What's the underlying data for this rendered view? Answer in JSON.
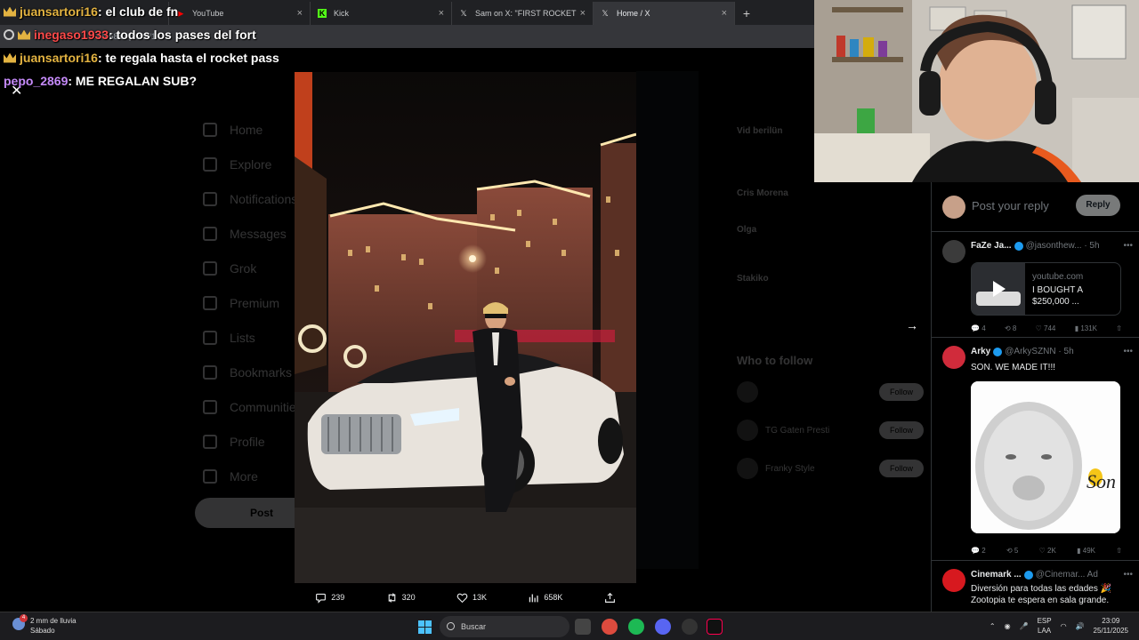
{
  "browser": {
    "tabs": [
      {
        "title": "YouTube",
        "icon": "youtube-icon",
        "active": false
      },
      {
        "title": "Kick",
        "icon": "kick-icon",
        "active": false
      },
      {
        "title": "Sam on X: \"FIRST ROCKET LEAG",
        "icon": "x-logo-icon",
        "active": false
      },
      {
        "title": "Home / X",
        "icon": "x-logo-icon",
        "active": true
      }
    ],
    "url": "...1765816/photo/1"
  },
  "chat": [
    {
      "user": "juansartori16",
      "message": " : el club de fn",
      "user_color": "#e3b341"
    },
    {
      "user": "inegaso1933",
      "message": " : todos los pases del fort",
      "user_color": "#ff4a4a"
    },
    {
      "user": "juansartori16",
      "message": " : te regala hasta el rocket pass",
      "user_color": "#e3b341"
    },
    {
      "user": "pepo_2869",
      "message": " : ME REGALAN SUB?",
      "user_color": "#c58af9"
    }
  ],
  "twitter_bg": {
    "sidebar": [
      "Home",
      "Explore",
      "Notifications",
      "Messages",
      "Grok",
      "Premium",
      "Lists",
      "Bookmarks",
      "Communities",
      "Profile",
      "More"
    ],
    "post_label": "Post",
    "trends": [
      {
        "name": "Vid berilün",
        "sub": ""
      },
      {
        "name": "Cris Morena",
        "sub": ""
      },
      {
        "name": "Olga",
        "sub": ""
      },
      {
        "name": "Stakiko",
        "sub": ""
      }
    ],
    "who_to_follow": "Who to follow",
    "follow_label": "Follow",
    "suggestions": [
      "TG Gaten Presti",
      "Franky Style"
    ]
  },
  "photo_actions": {
    "replies": "239",
    "reposts": "320",
    "likes": "13K",
    "views": "658K"
  },
  "reply_panel": {
    "placeholder": "Post your reply",
    "reply_button": "Reply",
    "tweets": [
      {
        "name": "FaZe Ja...",
        "handle": "@jasonthew... · 5h",
        "card_domain": "youtube.com",
        "card_title": "I BOUGHT A $250,000 ...",
        "stats": {
          "replies": "4",
          "reposts": "8",
          "likes": "744",
          "views": "131K"
        }
      },
      {
        "name": "Arky",
        "handle": "@ArkySZNN · 5h",
        "text": "SON. WE MADE IT!!!",
        "image_caption": "Son",
        "stats": {
          "replies": "2",
          "reposts": "5",
          "likes": "2K",
          "views": "49K"
        }
      },
      {
        "name": "Cinemark ...",
        "handle": "@Cinemar... Ad",
        "text1": "Diversión para todas las edades 🎉",
        "text2": "Zootopia te espera en sala grande."
      }
    ]
  },
  "taskbar": {
    "weather_line1": "2 mm de lluvia",
    "weather_line2": "Sábado",
    "weather_badge": "4",
    "search_placeholder": "Buscar",
    "lang1": "ESP",
    "lang2": "LAA",
    "time": "23:09",
    "date": "25/11/2025"
  },
  "colors": {
    "accent": "#1d9bf0",
    "bg": "#000000",
    "text": "#e7e9ea",
    "muted": "#71767b"
  }
}
